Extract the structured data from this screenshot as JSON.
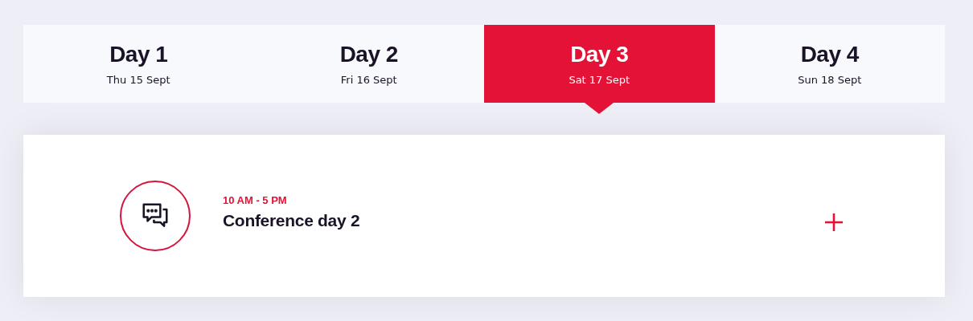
{
  "tabs": [
    {
      "label": "Day 1",
      "date": "Thu 15 Sept",
      "selected": false
    },
    {
      "label": "Day 2",
      "date": "Fri 16 Sept",
      "selected": false
    },
    {
      "label": "Day 3",
      "date": "Sat 17 Sept",
      "selected": true
    },
    {
      "label": "Day 4",
      "date": "Sun 18 Sept",
      "selected": false
    }
  ],
  "sessions": [
    {
      "time": "10 AM - 5 PM",
      "title": "Conference day 2",
      "expanded": false
    }
  ]
}
